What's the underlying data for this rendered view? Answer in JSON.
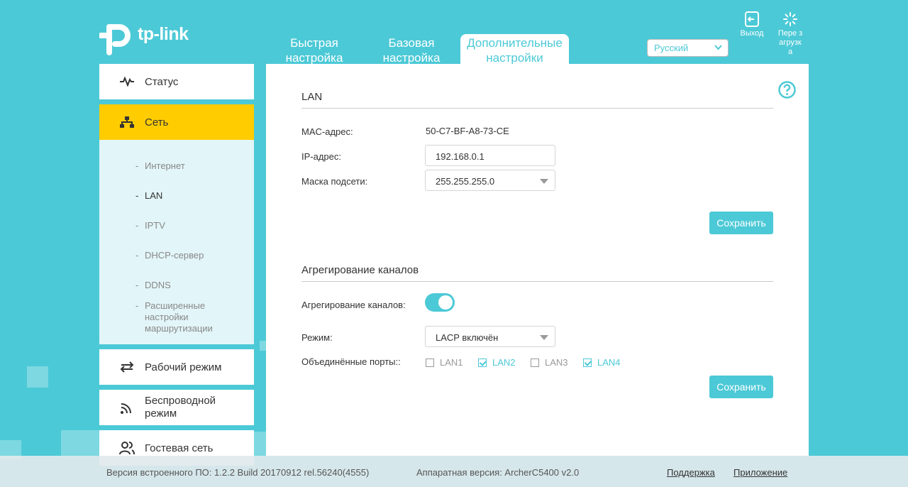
{
  "brand": {
    "name": "tp-link"
  },
  "tabs": [
    {
      "label": "Быстрая настройка"
    },
    {
      "label": "Базовая настройка"
    },
    {
      "label": "Дополнительные настройки"
    }
  ],
  "language": {
    "selected": "Русский"
  },
  "top_actions": {
    "logout": "Выход",
    "reboot": "Пере загрузк а"
  },
  "sidebar": {
    "items": [
      {
        "label": "Статус",
        "icon": "pulse-icon"
      },
      {
        "label": "Сеть",
        "icon": "network-icon"
      },
      {
        "label": "Рабочий режим",
        "icon": "swap-icon"
      },
      {
        "label": "Беспроводной режим",
        "icon": "wireless-icon"
      },
      {
        "label": "Гостевая сеть",
        "icon": "guests-icon"
      }
    ],
    "subitems": [
      {
        "label": "Интернет"
      },
      {
        "label": "LAN"
      },
      {
        "label": "IPTV"
      },
      {
        "label": "DHCP-сервер"
      },
      {
        "label": "DDNS"
      },
      {
        "label": "Расширенные настройки маршрутизации"
      }
    ],
    "active_item": "Сеть",
    "active_subitem": "LAN"
  },
  "lan": {
    "title": "LAN",
    "mac_label": "MAC-адрес:",
    "mac_value": "50-C7-BF-A8-73-CE",
    "ip_label": "IP-адрес:",
    "ip_value": "192.168.0.1",
    "mask_label": "Маска подсети:",
    "mask_value": "255.255.255.0",
    "save_label": "Сохранить"
  },
  "aggregation": {
    "title": "Агрегирование каналов",
    "toggle_label": "Агрегирование каналов:",
    "enabled": true,
    "mode_label": "Режим:",
    "mode_value": "LACP включён",
    "ports_label": "Объединённые порты::",
    "ports": [
      {
        "label": "LAN1",
        "checked": false
      },
      {
        "label": "LAN2",
        "checked": true
      },
      {
        "label": "LAN3",
        "checked": false
      },
      {
        "label": "LAN4",
        "checked": true
      }
    ],
    "save_label": "Сохранить"
  },
  "footer": {
    "firmware": "Версия встроенного ПО: 1.2.2 Build 20170912 rel.56240(4555)",
    "hardware": "Аппаратная версия: ArcherC5400 v2.0",
    "support": "Поддержка",
    "app": "Приложение"
  },
  "colors": {
    "accent": "#4cc9d6",
    "active_nav": "#ffcc00",
    "submenu_bg": "#e2f5f8"
  }
}
